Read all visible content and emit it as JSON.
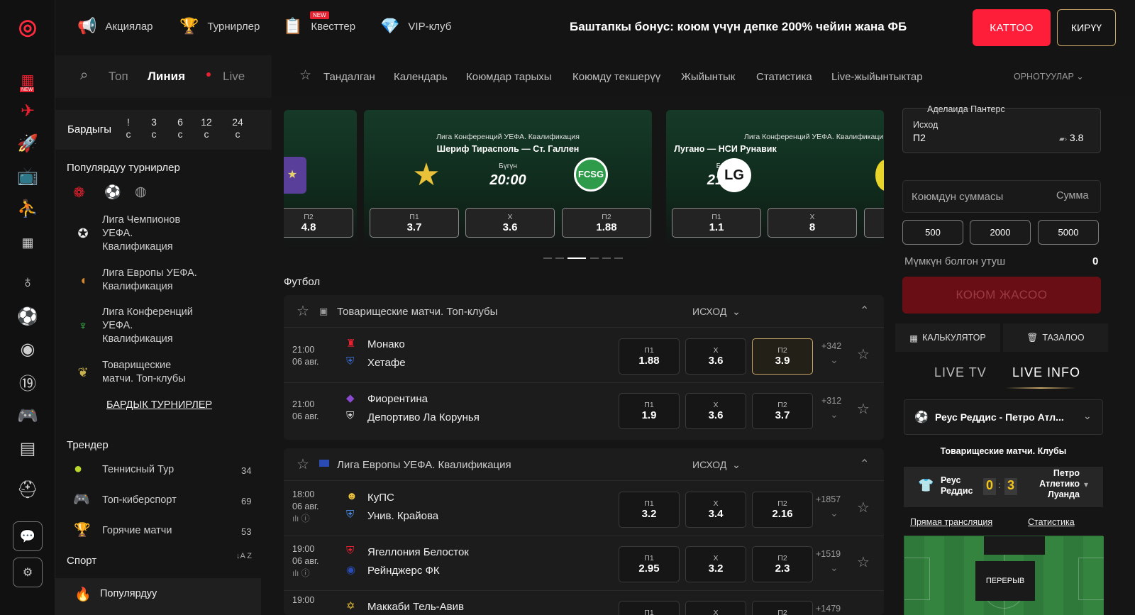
{
  "rail": {
    "items": [
      "logo-icon",
      "slot-new-icon",
      "plane-icon",
      "rocket-icon",
      "tv-icon",
      "basketball-icon",
      "bingo-icon",
      "globe-icon",
      "soccer-ball-icon",
      "target-icon",
      "number-19-icon",
      "gamepad-icon",
      "news-icon",
      "helmet-icon",
      "chat-icon",
      "settings-icon"
    ],
    "new_label": "NEW"
  },
  "top": {
    "promos": [
      {
        "label": "Акциялар"
      },
      {
        "label": "Турнирлер"
      },
      {
        "label": "Квесттер",
        "badge": "NEW"
      },
      {
        "label": "VIP-клуб"
      }
    ],
    "bonus": "Баштапкы бонус: коюм үчүн депке 200% чейин жана ФБ",
    "register": "КАТТОО",
    "login": "КИРҮҮ"
  },
  "sub": {
    "tabs": [
      "Топ",
      "Линия",
      "Live"
    ],
    "links": [
      "Тандалган",
      "Календарь",
      "Коюмдар тарыхы",
      "Коюмду текшерүү",
      "Жыйынтык",
      "Статистика",
      "Live-жыйынтыктар"
    ],
    "settings": "ОРНОТУУЛАР"
  },
  "left": {
    "periods_label": "Бардыгы",
    "periods": [
      {
        "n": "!",
        "u": "с"
      },
      {
        "n": "3",
        "u": "с"
      },
      {
        "n": "6",
        "u": "с"
      },
      {
        "n": "12",
        "u": "с"
      },
      {
        "n": "24",
        "u": "с"
      }
    ],
    "popular_title": "Популярдуу турнирлер",
    "tournaments": [
      {
        "l1": "Лига Чемпионов",
        "l2": "УЕФА.",
        "l3": "Квалификация"
      },
      {
        "l1": "Лига Европы УЕФА.",
        "l2": "Квалификация",
        "l3": ""
      },
      {
        "l1": "Лига Конференций",
        "l2": "УЕФА.",
        "l3": "Квалификация"
      },
      {
        "l1": "Товарищеские",
        "l2": "матчи. Топ-клубы",
        "l3": ""
      }
    ],
    "all_tournaments": "БАРДЫК ТУРНИРЛЕР",
    "trends_title": "Трендер",
    "trends": [
      {
        "label": "Теннисный Тур",
        "count": "34"
      },
      {
        "label": "Топ-киберспорт",
        "count": "69"
      },
      {
        "label": "Горячие матчи",
        "count": "53"
      }
    ],
    "sport_title": "Спорт",
    "sort": "A Z",
    "popular_item": "Популярдуу"
  },
  "carousel": [
    {
      "league": "",
      "teams": "",
      "date": "",
      "time": "",
      "odds": [
        {
          "k": "П2",
          "v": "4.8"
        }
      ]
    },
    {
      "league": "Лига Конференций УЕФА. Квалификация",
      "teams": "Шериф Тирасполь  —  Ст. Галлен",
      "date": "Бүгүн",
      "time": "20:00",
      "odds": [
        {
          "k": "П1",
          "v": "3.7"
        },
        {
          "k": "X",
          "v": "3.6"
        },
        {
          "k": "П2",
          "v": "1.88"
        }
      ]
    },
    {
      "league": "Лига Конференций УЕФА. Квалификаци",
      "teams": "Лугано  —  НСИ Рунавик",
      "date": "Бүгүн",
      "time": "21:30",
      "odds": [
        {
          "k": "П1",
          "v": "1.1"
        },
        {
          "k": "X",
          "v": "8"
        }
      ]
    }
  ],
  "sport_header": "Футбол",
  "blocks": [
    {
      "title": "Товарищеские матчи. Топ-клубы",
      "outcome": "ИСХОД",
      "rows": [
        {
          "time": "21:00",
          "date": "06 авг.",
          "home": "Монако",
          "away": "Хетафе",
          "p1": "1.88",
          "x": "3.6",
          "p2": "3.9",
          "more": "+342",
          "sel": "p2"
        },
        {
          "time": "21:00",
          "date": "06 авг.",
          "home": "Фиорентина",
          "away": "Депортиво Ла Корунья",
          "p1": "1.9",
          "x": "3.6",
          "p2": "3.7",
          "more": "+312",
          "sel": ""
        }
      ]
    },
    {
      "title": "Лига Европы УЕФА. Квалификация",
      "outcome": "ИСХОД",
      "rows": [
        {
          "time": "18:00",
          "date": "06 авг.",
          "home": "КуПС",
          "away": "Унив. Крайова",
          "p1": "3.2",
          "x": "3.4",
          "p2": "2.16",
          "more": "+1857",
          "sel": ""
        },
        {
          "time": "19:00",
          "date": "06 авг.",
          "home": "Ягеллония Белосток",
          "away": "Рейнджерс ФК",
          "p1": "2.95",
          "x": "3.2",
          "p2": "2.3",
          "more": "+1519",
          "sel": ""
        },
        {
          "time": "19:00",
          "date": "",
          "home": "Маккаби Тель-Авив",
          "away": "",
          "p1": "",
          "x": "",
          "p2": "",
          "more": "+1479",
          "sel": ""
        }
      ]
    }
  ],
  "odd_labels": {
    "p1": "П1",
    "x": "X",
    "p2": "П2"
  },
  "right": {
    "slip_team": "Аделаида Пантерс",
    "slip_market": "Исход",
    "slip_pick": "П2",
    "slip_odd": "3.8",
    "amount_label": "Коюмдун суммасы",
    "amount_placeholder": "Сумма",
    "quick": [
      "500",
      "2000",
      "5000"
    ],
    "win_label": "Мүмкүн болгон утуш",
    "win_value": "0",
    "place": "КОЮМ ЖАСОО",
    "calc": "КАЛЬКУЛЯТОР",
    "clear": "ТАЗАЛОО",
    "live_tv": "LIVE TV",
    "live_info": "LIVE INFO",
    "match_select": "Реус Реддис - Петро Атл...",
    "match_league": "Товарищеские матчи. Клубы",
    "home": "Реус Реддис",
    "home_l1": "Реус",
    "home_l2": "Реддис",
    "away_l1": "Петро",
    "away_l2": "Атлетико",
    "away_l3": "Луанда",
    "score_home": "0",
    "score_away": "3",
    "stream": "Прямая трансляция",
    "stats": "Статистика",
    "status": "ПЕРЕРЫВ"
  },
  "colors": {
    "accent": "#ff1e3a",
    "gold": "#c9a86a",
    "field": "#2f7a3a"
  }
}
